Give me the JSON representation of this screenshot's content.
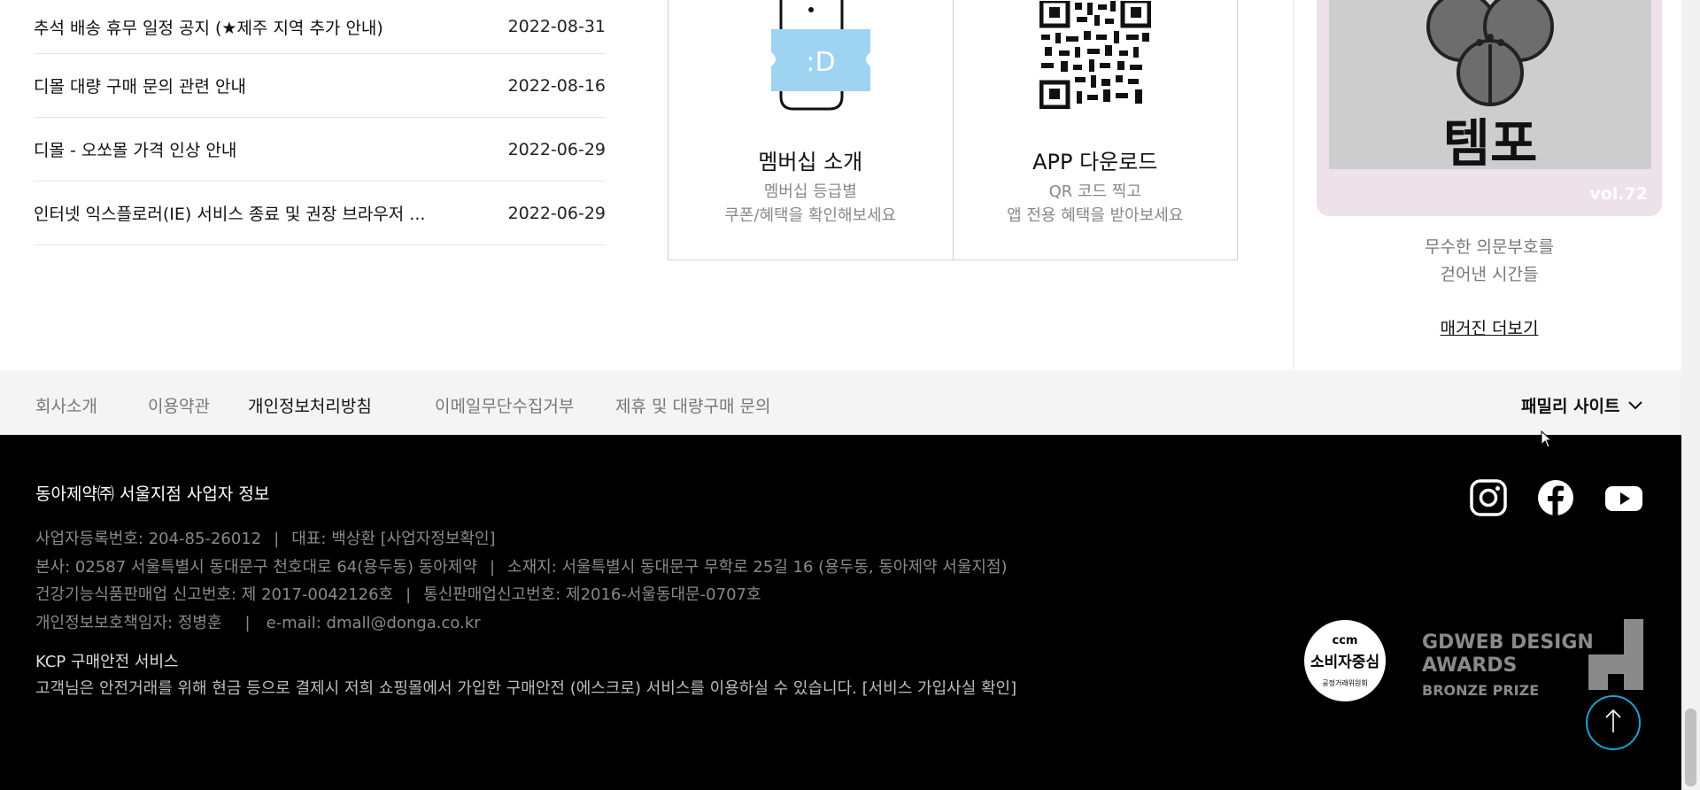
{
  "notices": [
    {
      "title": "추석 배송 휴무 일정 공지 (★제주 지역 추가 안내)",
      "date": "2022-08-31"
    },
    {
      "title": "디몰 대량 구매 문의 관련 안내",
      "date": "2022-08-16"
    },
    {
      "title": "디몰 - 오쏘몰 가격 인상 안내",
      "date": "2022-06-29"
    },
    {
      "title": "인터넷 익스플로러(IE) 서비스 종료 및 권장 브라우저 ...",
      "date": "2022-06-29"
    }
  ],
  "cards": {
    "membership": {
      "icon": "coupon-icon",
      "icon_text": ":D",
      "title": "멤버십 소개",
      "desc1": "멤버십 등급별",
      "desc2": "쿠폰/혜택을 확인해보세요"
    },
    "app": {
      "icon": "qr-code-icon",
      "title": "APP 다운로드",
      "desc1": "QR 코드 찍고",
      "desc2": "앱 전용 혜택을 받아보세요"
    }
  },
  "magazine": {
    "image_text": "템포",
    "vol": "vol.72",
    "line1": "무수한 의문부호를",
    "line2": "걷어낸 시간들",
    "more": "매거진 더보기"
  },
  "menubar": {
    "links": [
      "회사소개",
      "이용약관",
      "개인정보처리방침",
      "이메일무단수집거부",
      "제휴 및 대량구매 문의"
    ],
    "family": "패밀리 사이트"
  },
  "footer": {
    "company": "동아제약㈜ 서울지점 사업자 정보",
    "biz_no": "사업자등록번호: 204-85-26012",
    "ceo": "대표: 백상환 [사업자정보확인]",
    "hq": "본사: 02587 서울특별시 동대문구 천호대로 64(용두동) 동아제약",
    "location": "소재지: 서울특별시 동대문구 무학로 25길 16 (용두동, 동아제약 서울지점)",
    "health": "건강기능식품판매업 신고번호: 제 2017-0042126호",
    "mail_order": "통신판매업신고번호: 제2016-서울동대문-0707호",
    "privacy": "개인정보보호책임자: 정병훈",
    "email": "e-mail: dmall@donga.co.kr",
    "kcp_title": "KCP 구매안전 서비스",
    "kcp_text": "고객님은 안전거래를 위해 현금 등으로 결제시 저희 쇼핑몰에서 가입한 구매안전 (에스크로) 서비스를 이용하실 수 있습니다. [서비스 가입사실 확인]",
    "ccm": {
      "top": "ccm",
      "main": "소비자중심",
      "sub": "공정거래위원회"
    },
    "gdweb": {
      "line1": "GDWEB DESIGN",
      "line2": "AWARDS",
      "line3": "BRONZE PRIZE"
    }
  },
  "colors": {
    "accent": "#1aa3d3",
    "coupon": "#9ed3f1",
    "magazine_bg": "#ede2e9",
    "footer_bg": "#000000"
  }
}
